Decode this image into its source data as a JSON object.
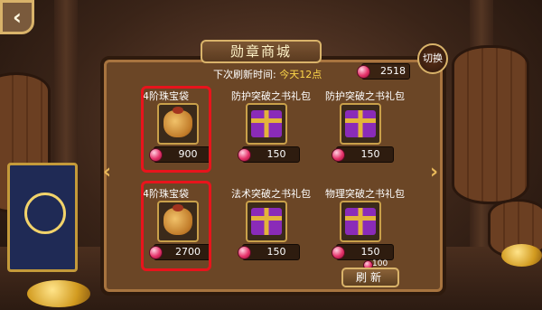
{
  "header": {
    "title": "勋章商城",
    "refresh_label": "下次刷新时间:",
    "refresh_value": "今天12点",
    "gems": "2518",
    "switch_label": "切换",
    "back_icon": "back-arrow-icon"
  },
  "items": [
    {
      "name": "4阶珠宝袋",
      "price": "900",
      "icon": "treasure-bag-icon"
    },
    {
      "name": "防护突破之书礼包",
      "price": "150",
      "icon": "gift-box-icon"
    },
    {
      "name": "防护突破之书礼包",
      "price": "150",
      "icon": "gift-box-icon"
    },
    {
      "name": "4阶珠宝袋",
      "price": "2700",
      "icon": "treasure-bag-icon"
    },
    {
      "name": "法术突破之书礼包",
      "price": "150",
      "icon": "gift-box-icon"
    },
    {
      "name": "物理突破之书礼包",
      "price": "150",
      "icon": "gift-box-icon"
    }
  ],
  "footer": {
    "refresh_button": "刷新",
    "refresh_cost": "100"
  },
  "colors": {
    "highlight": "#e8141c",
    "gem": "#e5336a",
    "accent": "#ffd84a"
  }
}
